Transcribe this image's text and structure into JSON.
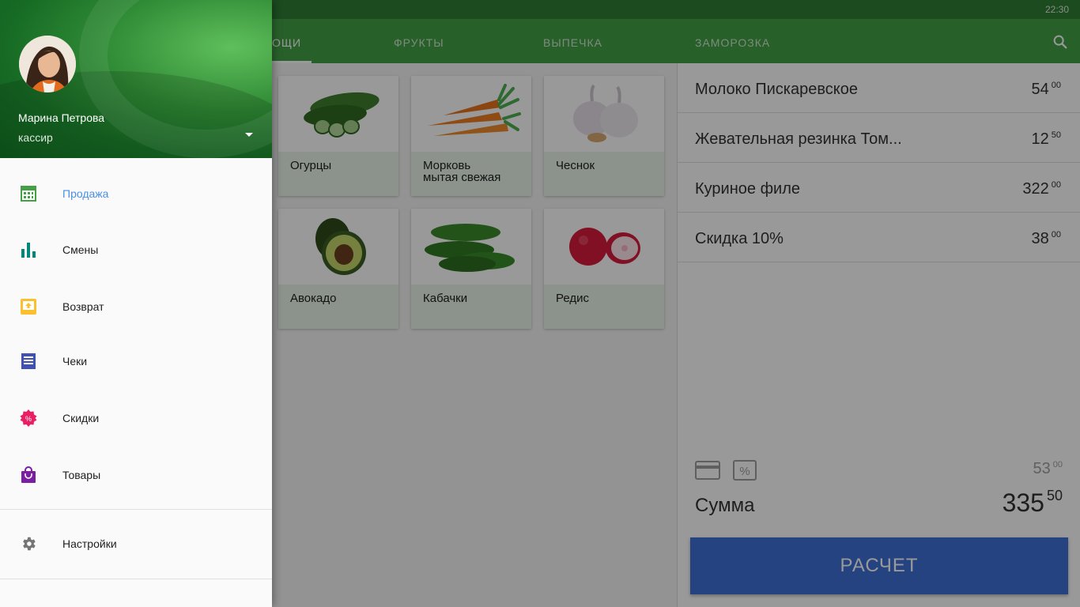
{
  "status": {
    "time": "22:30"
  },
  "tabs": [
    {
      "label": "ОЩИ",
      "active": true
    },
    {
      "label": "ФРУКТЫ",
      "active": false
    },
    {
      "label": "ВЫПЕЧКА",
      "active": false
    },
    {
      "label": "ЗАМОРОЗКА",
      "active": false
    }
  ],
  "products": [
    {
      "name": "Огурцы",
      "icon": "cucumber-icon"
    },
    {
      "name": "Морковь\nмытая свежая",
      "icon": "carrot-icon"
    },
    {
      "name": "Чеснок",
      "icon": "garlic-icon"
    },
    {
      "name": "Авокадо",
      "icon": "avocado-icon"
    },
    {
      "name": "Кабачки",
      "icon": "zucchini-icon"
    },
    {
      "name": "Редис",
      "icon": "radish-icon"
    }
  ],
  "cart": {
    "items": [
      {
        "name": "Молоко Пискаревское",
        "price_int": "54",
        "price_frac": "00"
      },
      {
        "name": "Жевательная резинка Том...",
        "price_int": "12",
        "price_frac": "50"
      },
      {
        "name": "Куриное филе",
        "price_int": "322",
        "price_frac": "00"
      },
      {
        "name": "Скидка 10%",
        "price_int": "38",
        "price_frac": "00"
      }
    ],
    "subtotal_int": "53",
    "subtotal_frac": "00",
    "sum_label": "Сумма",
    "sum_int": "335",
    "sum_frac": "50",
    "pay_label": "РАСЧЕТ"
  },
  "drawer": {
    "user_name": "Марина Петрова",
    "user_role": "кассир",
    "menu": [
      {
        "label": "Продажа",
        "icon": "calculator-icon",
        "color": "#43a047",
        "active": true
      },
      {
        "label": "Смены",
        "icon": "bar-chart-icon",
        "color": "#00897b",
        "active": false
      },
      {
        "label": "Возврат",
        "icon": "return-icon",
        "color": "#fbc02d",
        "active": false
      },
      {
        "label": "Чеки",
        "icon": "receipt-icon",
        "color": "#3f51b5",
        "active": false
      },
      {
        "label": "Скидки",
        "icon": "discount-icon",
        "color": "#e91e63",
        "active": false
      },
      {
        "label": "Товары",
        "icon": "shopping-bag-icon",
        "color": "#7b1fa2",
        "active": false
      }
    ],
    "settings": {
      "label": "Настройки",
      "icon": "gear-icon",
      "color": "#757575"
    }
  },
  "colors": {
    "primary": "#43a047",
    "primary_dark": "#2e7d32",
    "accent_blue": "#3f6ed8",
    "active_menu_text": "#4a90e2"
  }
}
